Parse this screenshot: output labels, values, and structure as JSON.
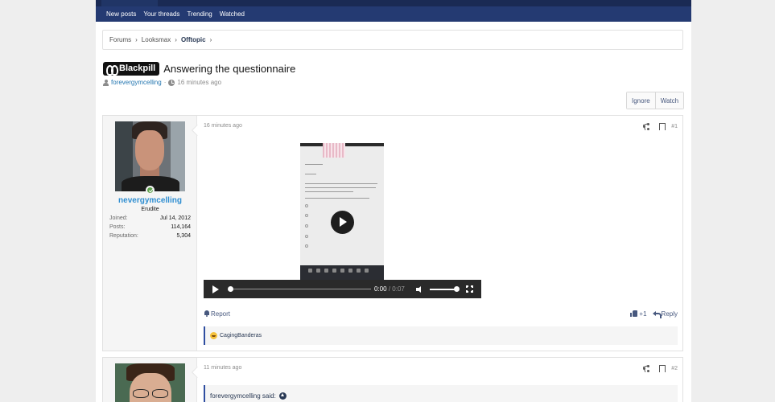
{
  "nav": {
    "items": [
      "New posts",
      "Your threads",
      "Trending",
      "Watched"
    ]
  },
  "breadcrumb": {
    "items": [
      "Forums",
      "Looksmax",
      "Offtopic"
    ]
  },
  "thread": {
    "prefix": "Blackpill",
    "title": "Answering the questionnaire",
    "author": "forevergymcelling",
    "time": "16 minutes ago",
    "separator": "·"
  },
  "buttons": {
    "ignore": "Ignore",
    "watch": "Watch"
  },
  "posts": [
    {
      "time": "16 minutes ago",
      "number": "#1",
      "user": {
        "name": "nevergymcelling",
        "title": "Erudite",
        "stats": [
          {
            "label": "Joined:",
            "value": "Jul 14, 2012"
          },
          {
            "label": "Posts:",
            "value": "114,164"
          },
          {
            "label": "Reputation:",
            "value": "5,304"
          }
        ]
      },
      "video": {
        "current": "0:00",
        "separator": "/",
        "duration": "0:07"
      },
      "footer": {
        "report": "Report",
        "likes": "+1",
        "reply": "Reply"
      },
      "reactions": "CagingBanderas"
    },
    {
      "time": "11 minutes ago",
      "number": "#2",
      "quote": "forevergymcelling said:"
    }
  ],
  "colors": {
    "nav_bg": "#243a72",
    "link": "#2577b1",
    "username": "#2f8ed1",
    "accent": "#2f4ea0"
  }
}
